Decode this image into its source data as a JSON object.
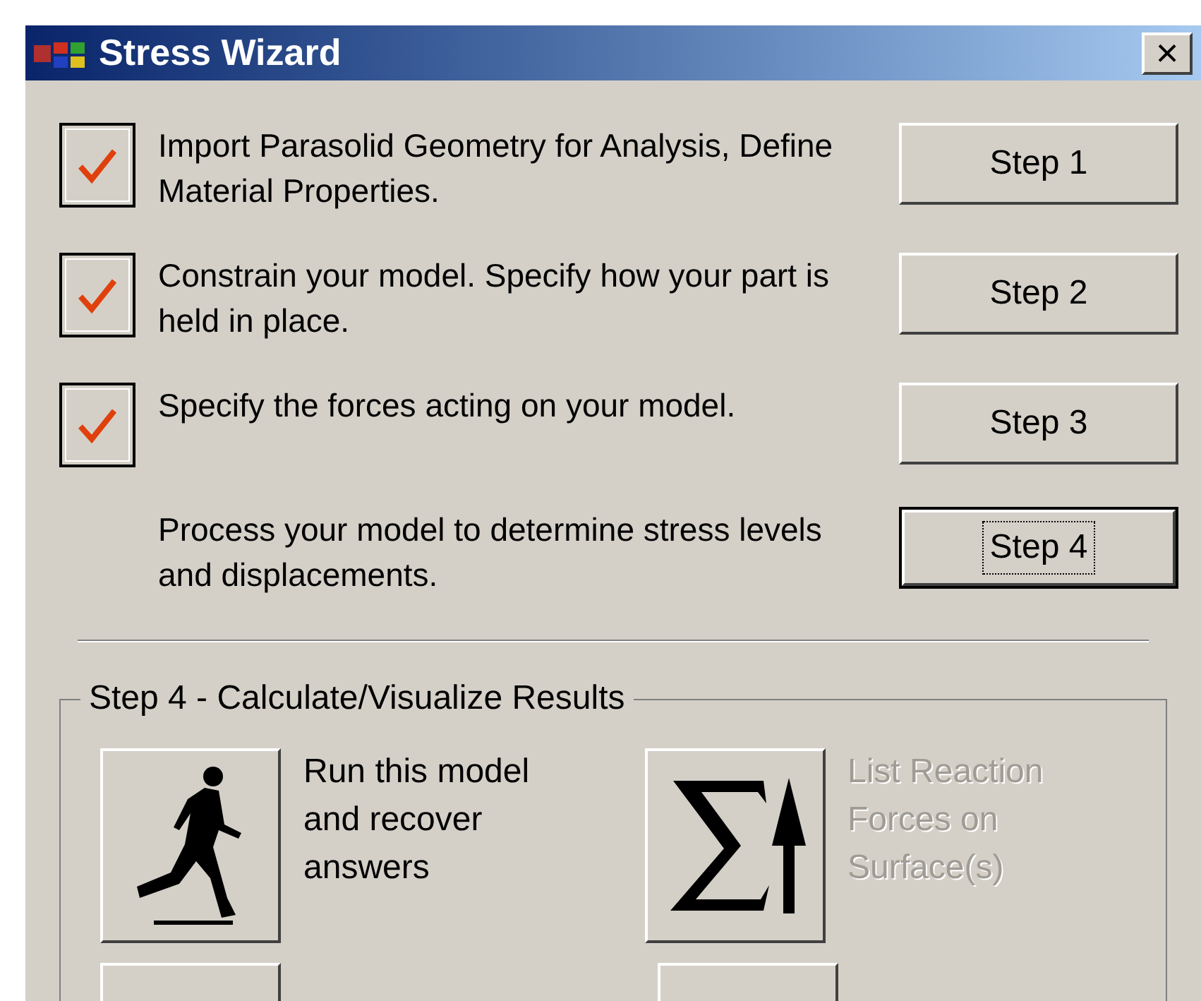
{
  "window": {
    "title": "Stress Wizard",
    "close": "×"
  },
  "steps": [
    {
      "text": "Import Parasolid Geometry for Analysis, Define Material Properties.",
      "checked": true,
      "button": "Step 1",
      "focused": false
    },
    {
      "text": "Constrain your model. Specify how your part is held in place.",
      "checked": true,
      "button": "Step 2",
      "focused": false
    },
    {
      "text": "Specify the forces acting on your model.",
      "checked": true,
      "button": "Step 3",
      "focused": false
    },
    {
      "text": "Process your model to determine stress levels and displacements.",
      "button": "Step 4",
      "focused": true
    }
  ],
  "group": {
    "title": "Step 4 - Calculate/Visualize Results",
    "actions": [
      {
        "kind": "run",
        "text": "Run this model and recover answers",
        "disabled": false
      },
      {
        "kind": "sigma",
        "text": "List Reaction Forces on Surface(s)",
        "disabled": true
      }
    ]
  }
}
